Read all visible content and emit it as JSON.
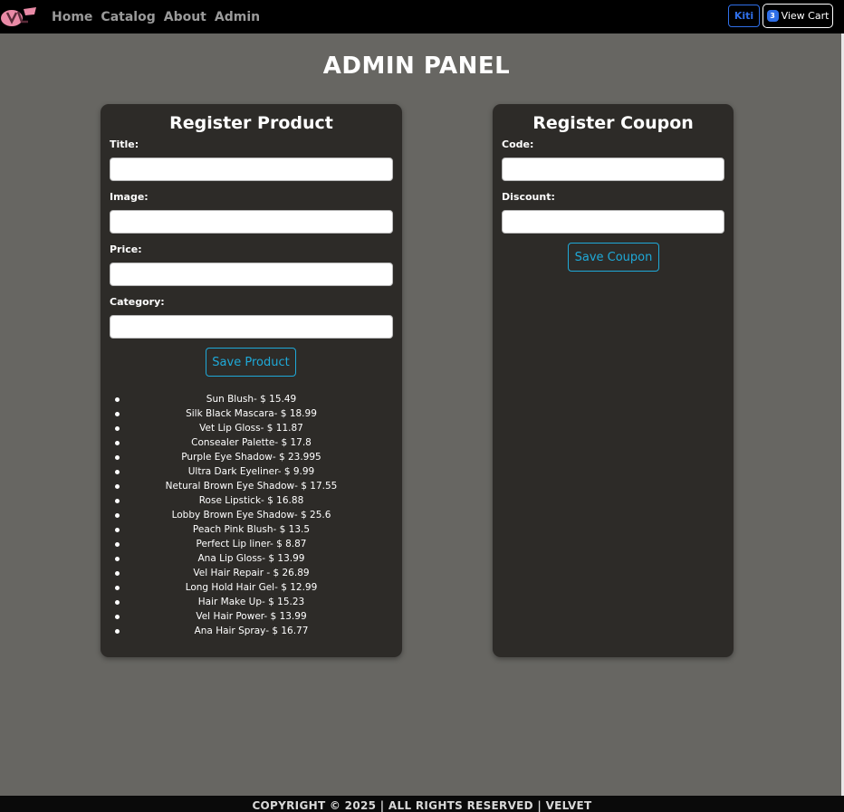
{
  "nav": {
    "links": [
      "Home",
      "Catalog",
      "About",
      "Admin"
    ],
    "user_label": "Kiti",
    "cart_count": "3",
    "cart_label": "View Cart"
  },
  "page_title": "ADMIN PANEL",
  "product_form": {
    "title": "Register Product",
    "fields": [
      {
        "label": "Title:",
        "value": ""
      },
      {
        "label": "Image:",
        "value": ""
      },
      {
        "label": "Price:",
        "value": ""
      },
      {
        "label": "Category:",
        "value": ""
      }
    ],
    "save_label": "Save Product"
  },
  "products": [
    "Sun Blush- $ 15.49",
    "Silk Black Mascara- $ 18.99",
    "Vet Lip Gloss- $ 11.87",
    "Consealer Palette- $ 17.8",
    "Purple Eye Shadow- $ 23.995",
    "Ultra Dark Eyeliner- $ 9.99",
    "Netural Brown Eye Shadow- $ 17.55",
    "Rose Lipstick- $ 16.88",
    "Lobby Brown Eye Shadow- $ 25.6",
    "Peach Pink Blush- $ 13.5",
    "Perfect Lip liner- $ 8.87",
    "Ana Lip Gloss- $ 13.99",
    "Vel Hair Repair - $ 26.89",
    "Long Hold Hair Gel- $ 12.99",
    "Hair Make Up- $ 15.23",
    "Vel Hair Power- $ 13.99",
    "Ana Hair Spray- $ 16.77"
  ],
  "coupon_form": {
    "title": "Register Coupon",
    "fields": [
      {
        "label": "Code:",
        "value": ""
      },
      {
        "label": "Discount:",
        "value": ""
      }
    ],
    "save_label": "Save Coupon"
  },
  "footer": "COPYRIGHT © 2025 | ALL RIGHTS RESERVED | VELVET",
  "colors": {
    "background": "#676662",
    "panel": "#2d2b28",
    "accent": "#1fa9d8",
    "nav_badge": "#2f6fe8",
    "logo": "#e98aa6"
  }
}
